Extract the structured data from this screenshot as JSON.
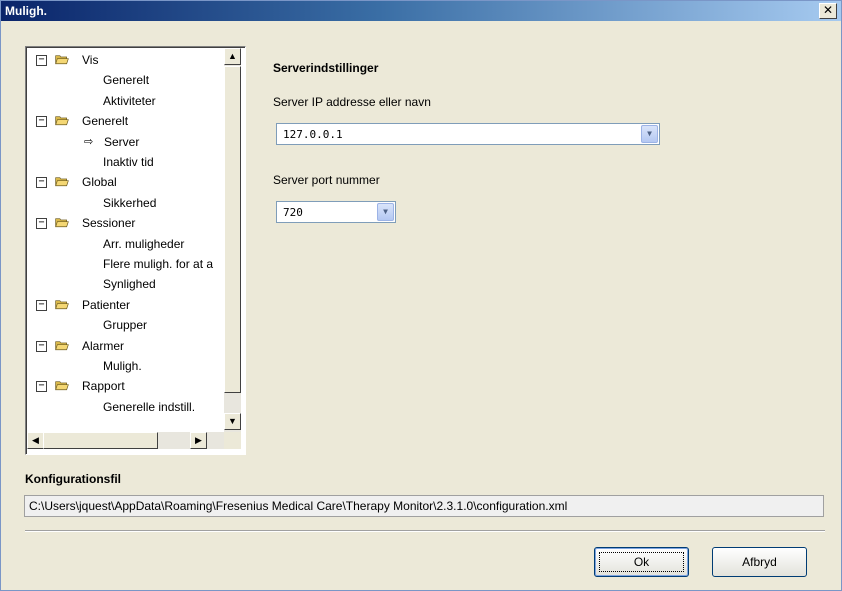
{
  "window": {
    "title": "Muligh.",
    "close_glyph": "✕"
  },
  "tree": {
    "items": [
      {
        "label": "Vis",
        "type": "folder",
        "expanded": true
      },
      {
        "label": "Generelt",
        "type": "leaf"
      },
      {
        "label": "Aktiviteter",
        "type": "leaf"
      },
      {
        "label": "Generelt",
        "type": "folder",
        "expanded": true
      },
      {
        "label": "Server",
        "type": "leaf",
        "selected": true
      },
      {
        "label": "Inaktiv tid",
        "type": "leaf"
      },
      {
        "label": "Global",
        "type": "folder",
        "expanded": true
      },
      {
        "label": "Sikkerhed",
        "type": "leaf"
      },
      {
        "label": "Sessioner",
        "type": "folder",
        "expanded": true
      },
      {
        "label": "Arr. muligheder",
        "type": "leaf"
      },
      {
        "label": "Flere muligh. for at a",
        "type": "leaf"
      },
      {
        "label": "Synlighed",
        "type": "leaf"
      },
      {
        "label": "Patienter",
        "type": "folder",
        "expanded": true
      },
      {
        "label": "Grupper",
        "type": "leaf"
      },
      {
        "label": "Alarmer",
        "type": "folder",
        "expanded": true
      },
      {
        "label": "Muligh.",
        "type": "leaf"
      },
      {
        "label": "Rapport",
        "type": "folder",
        "expanded": true
      },
      {
        "label": "Generelle indstill.",
        "type": "leaf"
      }
    ],
    "expander_glyph": "−",
    "selected_arrow_glyph": "⇨"
  },
  "server": {
    "section_title": "Serverindstillinger",
    "ip_label": "Server IP addresse eller navn",
    "ip_value": "127.0.0.1",
    "port_label": "Server port nummer",
    "port_value": "720"
  },
  "config": {
    "label": "Konfigurationsfil",
    "path": "C:\\Users\\jquest\\AppData\\Roaming\\Fresenius Medical Care\\Therapy Monitor\\2.3.1.0\\configuration.xml"
  },
  "buttons": {
    "ok": "Ok",
    "cancel": "Afbryd"
  },
  "colors": {
    "titlebar_start": "#0a246a",
    "folder": "#f4d774"
  }
}
